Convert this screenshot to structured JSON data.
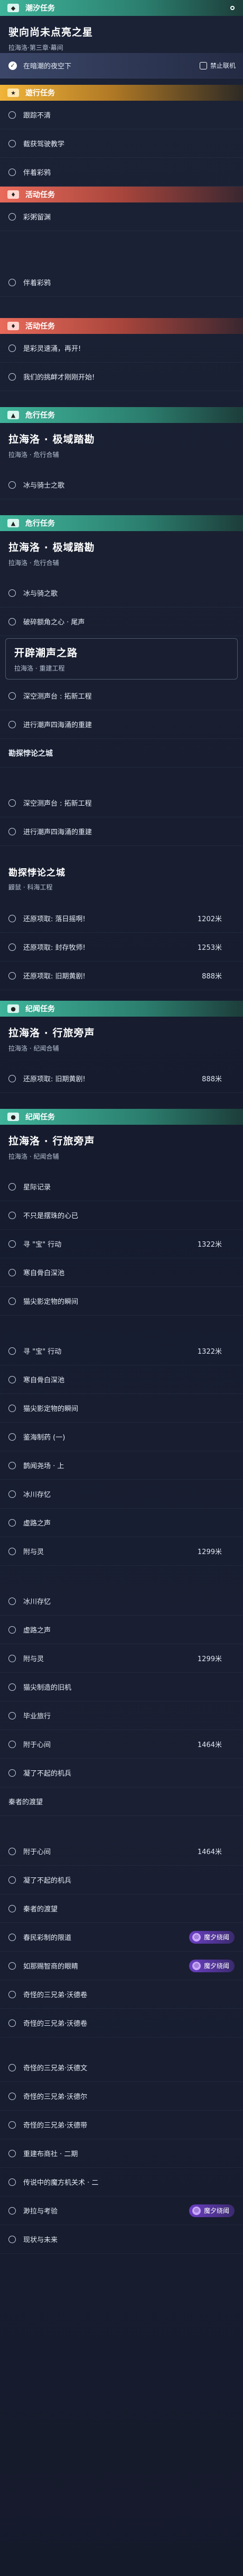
{
  "colors": {
    "teal": "#3fb49a",
    "orange": "#f0b43a",
    "red": "#e86a5a",
    "purple": "#6b3fc2",
    "pink": "#e04d6a"
  },
  "top_title": "潮汐任务",
  "main": {
    "title": "驶向尚未点亮之星",
    "subtitle": "拉海洛·第三章·幕间"
  },
  "active": {
    "label": "在暗潮的夜空下",
    "tag": "禁止联机"
  },
  "sec1": {
    "title": "遊行任务",
    "items": [
      "跟踪不清",
      "截获驾驶教学",
      "伴着彩鸦"
    ]
  },
  "sec2": {
    "title": "活动任务",
    "items": [
      "彩粥留渊"
    ]
  },
  "sec3": {
    "title": "活动任务",
    "items": [
      "伴着彩鸦"
    ]
  },
  "sec4": {
    "title": "活动任务",
    "items": [
      "是彩灵速涌，再开!",
      "我们的挑衅才刚刚开始!"
    ]
  },
  "sec5": {
    "title": "危行任务",
    "block": {
      "title": "拉海洛 · 极域踏勘",
      "subtitle": "拉海洛 · 危行合辅"
    },
    "items": [
      "冰与骑士之歌"
    ]
  },
  "sec6": {
    "title": "危行任务",
    "block": {
      "title": "拉海洛 · 极域踏勘",
      "subtitle": "拉海洛 · 危行合辅"
    },
    "items": [
      "冰与骑之歌",
      "破碎额角之心 · 尾声"
    ],
    "block2": {
      "title": "开辟潮声之路",
      "subtitle": "拉海洛 · 重建工程"
    },
    "items2": [
      "深空测声台 : 拓新工程",
      "进行潮声四海涌的重建"
    ]
  },
  "sec7": {
    "title": "勘探悖论之城",
    "items": [
      "深空测声台 : 拓新工程",
      "进行潮声四海涌的重建"
    ]
  },
  "sec8": {
    "block": {
      "title": "勘探悖论之城",
      "subtitle": "鼹鼠 · 科海工程"
    },
    "items": [
      {
        "label": "还原项取: 落日摇啊!",
        "num": "1202米"
      },
      {
        "label": "还原项取: 封存牧师!",
        "num": "1253米"
      },
      {
        "label": "还原项取: 旧期黄剧!",
        "num": "888米"
      }
    ]
  },
  "sec9": {
    "title": "纪闻任务",
    "block": {
      "title": "拉海洛 · 行旅旁声",
      "subtitle": "拉海洛 · 纪闻合辅"
    },
    "items": [
      {
        "label": "还原项取: 旧期黄剧!",
        "num": "888米"
      }
    ]
  },
  "sec10": {
    "title": "纪闻任务",
    "block": {
      "title": "拉海洛 · 行旅旁声",
      "subtitle": "拉海洛 · 纪闻合辅"
    },
    "items": [
      {
        "label": "星际记录",
        "num": ""
      },
      {
        "label": "不只是摆珠的心已",
        "num": ""
      },
      {
        "label": "寻 \"宝\" 行动",
        "num": "1322米"
      },
      {
        "label": "寒自骨白深池",
        "num": ""
      },
      {
        "label": "猫尖影定物的瞬间",
        "num": ""
      }
    ]
  },
  "list2": [
    {
      "label": "寻 \"宝\" 行动",
      "num": "1322米"
    },
    {
      "label": "寒自骨白深池",
      "num": ""
    },
    {
      "label": "猫尖影定物的瞬间",
      "num": ""
    },
    {
      "label": "鉴海制药 (一)",
      "num": ""
    },
    {
      "label": "鹊闻尧场 · 上",
      "num": ""
    },
    {
      "label": "冰川存忆",
      "num": ""
    },
    {
      "label": "虚路之声",
      "num": ""
    },
    {
      "label": "附与灵",
      "num": "1299米"
    }
  ],
  "list3": [
    {
      "label": "冰川存忆",
      "num": ""
    },
    {
      "label": "虚路之声",
      "num": ""
    },
    {
      "label": "附与灵",
      "num": "1299米"
    },
    {
      "label": "猫尖制造的旧机",
      "num": ""
    },
    {
      "label": "毕业旅行",
      "num": ""
    },
    {
      "label": "附于心间",
      "num": "1464米"
    },
    {
      "label": "凝了不起的机兵",
      "num": ""
    }
  ],
  "sep": "秦者的渡望",
  "list4": [
    {
      "label": "附于心间",
      "num": "1464米",
      "tag": ""
    },
    {
      "label": "凝了不起的机兵",
      "num": "",
      "tag": ""
    },
    {
      "label": "秦者的渡望",
      "num": "",
      "tag": ""
    },
    {
      "label": "春民彩制的限道",
      "num": "",
      "tag": "魔夕绕阈"
    },
    {
      "label": "如那赐智商的眼睛",
      "num": "",
      "tag": "魔夕绕阈"
    },
    {
      "label": "奇怪的三兄弟·沃德卷",
      "num": "",
      "tag": ""
    },
    {
      "label": "奇怪的三兄弟·沃德卷",
      "num": "",
      "tag": ""
    }
  ],
  "list5": [
    {
      "label": "奇怪的三兄弟·沃德文",
      "num": "",
      "tag": ""
    },
    {
      "label": "奇怪的三兄弟·沃德尔",
      "num": "",
      "tag": ""
    },
    {
      "label": "奇怪的三兄弟·沃德带",
      "num": "",
      "tag": ""
    },
    {
      "label": "重建布商社 · 二期",
      "num": "",
      "tag": ""
    },
    {
      "label": "传说中的魔方机关术 · 二",
      "num": "",
      "tag": ""
    },
    {
      "label": "渺拉与考验",
      "num": "",
      "tag": "魔夕绕阈"
    },
    {
      "label": "现状与未来",
      "num": "",
      "tag": ""
    }
  ]
}
